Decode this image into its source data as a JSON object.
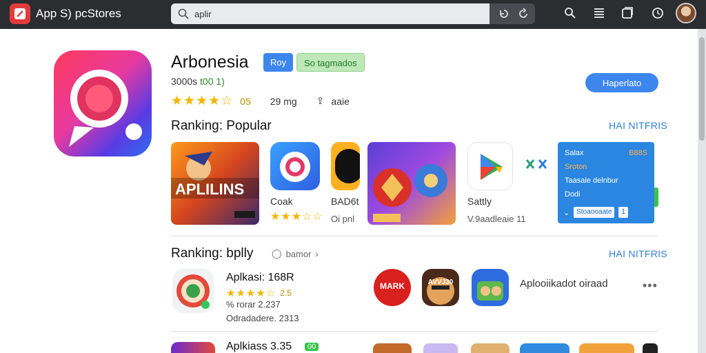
{
  "topbar": {
    "brand": "App S) pcStores",
    "search_value": "aplir",
    "icons": [
      "search-icon",
      "refresh-icon",
      "reload-icon",
      "zoom-icon",
      "list-icon",
      "window-icon",
      "clock-icon"
    ]
  },
  "hero": {
    "title": "Arbonesia",
    "badge_primary": "Roy",
    "badge_secondary": "So tagmados",
    "subline_prefix": "3000s ",
    "subline_highlight": "t00 1)",
    "rating_value": "05",
    "size": "29 mg",
    "share": "aaie",
    "cta_label": "Haperlato"
  },
  "ranking_popular": {
    "title": "Ranking: Popular",
    "see_all": "HAI NITFRIS",
    "tiles": [
      {
        "name": "APLILINS",
        "sub": ""
      },
      {
        "name": "Coak",
        "sub": ""
      },
      {
        "name": "BAD6t",
        "sub": "Oi pnl"
      },
      {
        "name": "",
        "sub": ""
      },
      {
        "name": "Sattly",
        "sub": "V.9aadleaie 11"
      }
    ],
    "card": {
      "row1_left": "Salax",
      "row1_right": "B88S",
      "row2": "Sroton",
      "row3": "Taasaie delnbur",
      "row4": "Dodi",
      "box_label": "Stoaooaate",
      "box_count": "1"
    }
  },
  "ranking_bplly": {
    "title": "Ranking: bplly",
    "chip": "bamor",
    "see_all": "HAI NITFRIS",
    "items": [
      {
        "title": "Aplkasi: 168R",
        "rating": "2.5",
        "line2": "% rorar 2.237",
        "line3": "Odradadere. 2313"
      },
      {
        "title": "Aplkiass 3.35",
        "badge": "00"
      }
    ],
    "round_labels": [
      "MARK",
      "AVVJ30"
    ],
    "side_text": "Aplooiikadot oiraad",
    "more": "•••"
  }
}
